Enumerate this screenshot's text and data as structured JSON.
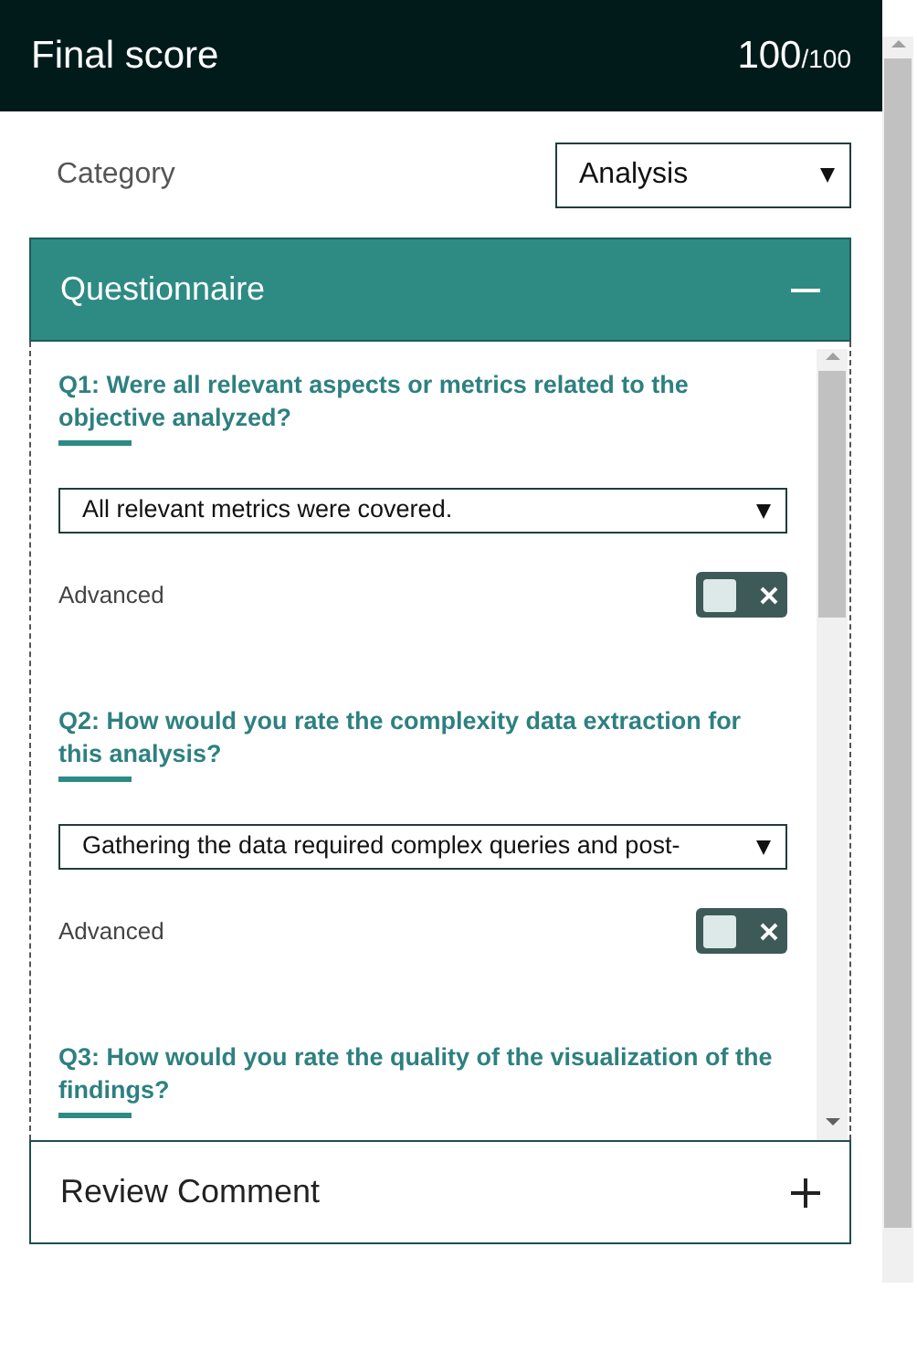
{
  "header": {
    "title": "Final score",
    "score": "100",
    "max": "/100"
  },
  "category": {
    "label": "Category",
    "value": "Analysis"
  },
  "sections": [
    {
      "title": "Questionnaire",
      "expanded": true,
      "questions": [
        {
          "text": "Q1: Were all relevant aspects or metrics related to the objective analyzed?",
          "answer": "All relevant metrics were covered.",
          "advanced_label": "Advanced",
          "on": false
        },
        {
          "text": "Q2: How would you rate the complexity data extraction for this analysis?",
          "answer": "Gathering the data required complex queries and post-",
          "advanced_label": "Advanced",
          "on": false
        },
        {
          "text": "Q3: How would you rate the quality of the visualization of the findings?"
        }
      ]
    },
    {
      "title": "Review Comment",
      "expanded": false
    }
  ]
}
